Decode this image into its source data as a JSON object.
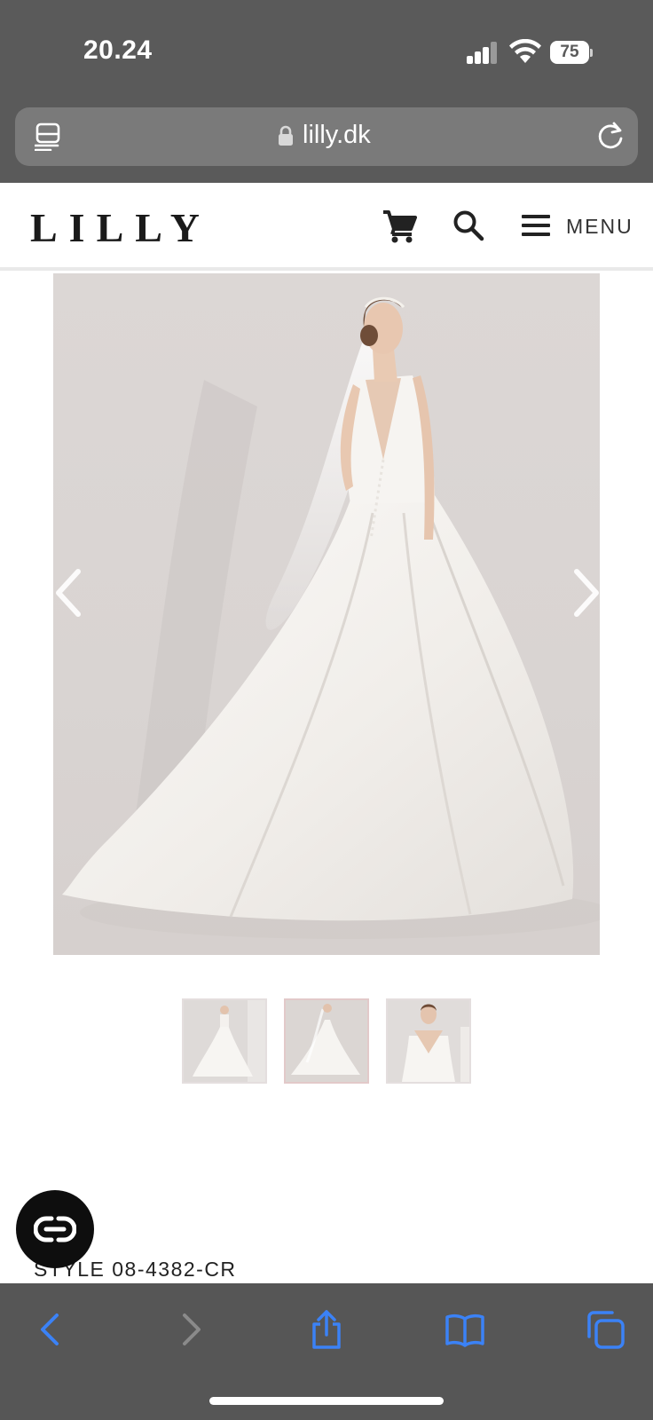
{
  "status_bar": {
    "time": "20.24",
    "battery": "75"
  },
  "browser": {
    "url": "lilly.dk"
  },
  "site": {
    "logo": "LILLY",
    "menu_label": "MENU"
  },
  "product": {
    "style_code": "STYLE 08-4382-CR",
    "images_count": 3,
    "selected_image": 2
  },
  "colors": {
    "chrome_bg": "#5a5a5a",
    "address_bar_bg": "#7a7a7a",
    "toolbar_bg": "#565656",
    "ios_blue": "#3b82f6",
    "logo_color": "#1a1a1a",
    "photo_bg": "#dcd7d5"
  },
  "icons": {
    "reader": "reader-mode-icon",
    "lock": "lock-icon",
    "reload": "reload-icon",
    "cart": "cart-icon",
    "search": "search-icon",
    "menu": "hamburger-icon",
    "gallery_prev": "chevron-left-icon",
    "gallery_next": "chevron-right-icon",
    "chat": "chat-icon",
    "back": "back-icon",
    "forward": "forward-icon",
    "share": "share-icon",
    "bookmarks": "bookmarks-icon",
    "tabs": "tabs-icon"
  }
}
